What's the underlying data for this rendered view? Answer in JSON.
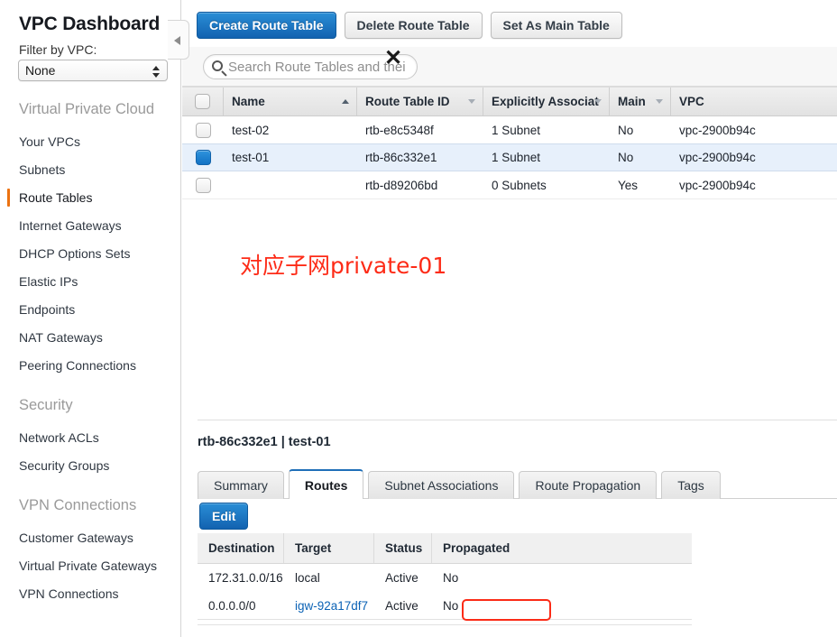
{
  "sidebar": {
    "title": "VPC Dashboard",
    "filter_label": "Filter by VPC:",
    "filter_value": "None",
    "groups": [
      {
        "title": "Virtual Private Cloud",
        "items": [
          {
            "label": "Your VPCs",
            "active": false
          },
          {
            "label": "Subnets",
            "active": false
          },
          {
            "label": "Route Tables",
            "active": true
          },
          {
            "label": "Internet Gateways",
            "active": false
          },
          {
            "label": "DHCP Options Sets",
            "active": false
          },
          {
            "label": "Elastic IPs",
            "active": false
          },
          {
            "label": "Endpoints",
            "active": false
          },
          {
            "label": "NAT Gateways",
            "active": false
          },
          {
            "label": "Peering Connections",
            "active": false
          }
        ]
      },
      {
        "title": "Security",
        "items": [
          {
            "label": "Network ACLs",
            "active": false
          },
          {
            "label": "Security Groups",
            "active": false
          }
        ]
      },
      {
        "title": "VPN Connections",
        "items": [
          {
            "label": "Customer Gateways",
            "active": false
          },
          {
            "label": "Virtual Private Gateways",
            "active": false
          },
          {
            "label": "VPN Connections",
            "active": false
          }
        ]
      }
    ]
  },
  "toolbar": {
    "create_label": "Create Route Table",
    "delete_label": "Delete Route Table",
    "set_main_label": "Set As Main Table"
  },
  "search": {
    "placeholder": "Search Route Tables and their",
    "value": "",
    "clear_glyph": "✕"
  },
  "route_tables": {
    "columns": [
      {
        "label": "Name",
        "sort": "asc"
      },
      {
        "label": "Route Table ID",
        "sort": "desc"
      },
      {
        "label": "Explicitly Associat",
        "sort": "desc"
      },
      {
        "label": "Main",
        "sort": "desc"
      },
      {
        "label": "VPC",
        "sort": "none"
      }
    ],
    "rows": [
      {
        "selected": false,
        "name": "test-02",
        "id": "rtb-e8c5348f",
        "assoc": "1 Subnet",
        "main": "No",
        "vpc": "vpc-2900b94c"
      },
      {
        "selected": true,
        "name": "test-01",
        "id": "rtb-86c332e1",
        "assoc": "1 Subnet",
        "main": "No",
        "vpc": "vpc-2900b94c"
      },
      {
        "selected": false,
        "name": "",
        "id": "rtb-d89206bd",
        "assoc": "0 Subnets",
        "main": "Yes",
        "vpc": "vpc-2900b94c"
      }
    ]
  },
  "annotation": {
    "text": "对应子网private-01",
    "color": "#fd2b17"
  },
  "detail": {
    "title": "rtb-86c332e1 | test-01",
    "tabs": [
      {
        "label": "Summary",
        "active": false
      },
      {
        "label": "Routes",
        "active": true
      },
      {
        "label": "Subnet Associations",
        "active": false
      },
      {
        "label": "Route Propagation",
        "active": false
      },
      {
        "label": "Tags",
        "active": false
      }
    ],
    "edit_label": "Edit",
    "routes": {
      "columns": [
        "Destination",
        "Target",
        "Status",
        "Propagated"
      ],
      "rows": [
        {
          "destination": "172.31.0.0/16",
          "target": "local",
          "target_is_link": false,
          "target_highlighted": false,
          "status": "Active",
          "propagated": "No"
        },
        {
          "destination": "0.0.0.0/0",
          "target": "igw-92a17df7",
          "target_is_link": true,
          "target_highlighted": true,
          "status": "Active",
          "propagated": "No"
        }
      ]
    }
  },
  "colors": {
    "primary_blue": "#1272c4",
    "active_nav_orange": "#ec7211",
    "selected_row": "#e7f0fb",
    "status_active_green": "#1f7a1f",
    "link_blue": "#0b62b5",
    "highlight_red": "#fb2b17"
  }
}
